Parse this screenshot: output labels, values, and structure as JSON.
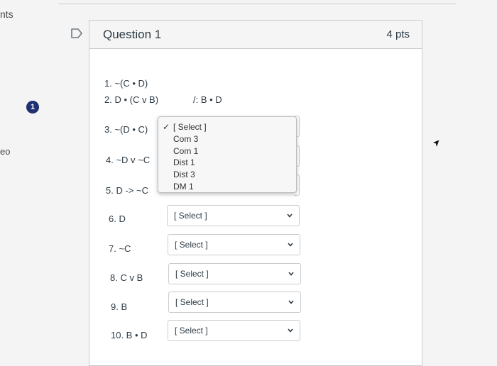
{
  "page_edge": {
    "left_text_top": "nts",
    "left_text_mid": "eo"
  },
  "question_badge": "1",
  "question": {
    "title": "Question 1",
    "points": "4 pts"
  },
  "premises": [
    {
      "text": "1. ~(C • D)"
    },
    {
      "text": "2. D • (C v B)"
    }
  ],
  "conclusion": "/: B • D",
  "steps": [
    {
      "text": "3. ~(D • C)"
    },
    {
      "text": "4.  ~D v ~C"
    },
    {
      "text": "5.  D -> ~C"
    },
    {
      "text": "6.  D",
      "select": "[ Select ]"
    },
    {
      "text": "7. ~C",
      "select": "[ Select ]"
    },
    {
      "text": "8. C v B",
      "select": "[ Select ]"
    },
    {
      "text": "9.  B",
      "select": "[ Select ]"
    },
    {
      "text": "10. B • D",
      "select": "[ Select ]"
    }
  ],
  "dropdown": {
    "selected_mark": "✓",
    "options": [
      "[ Select ]",
      "Com 3",
      "Com 1",
      "Dist 1",
      "Dist 3",
      "DM 1"
    ]
  },
  "icons": {
    "flag": "flag-outline-icon",
    "chevron": "chevron-down-icon",
    "cursor": "mouse-pointer-icon"
  },
  "colors": {
    "badge": "#1f2f70",
    "text": "#2d3b45",
    "border": "#c7cdd1"
  }
}
